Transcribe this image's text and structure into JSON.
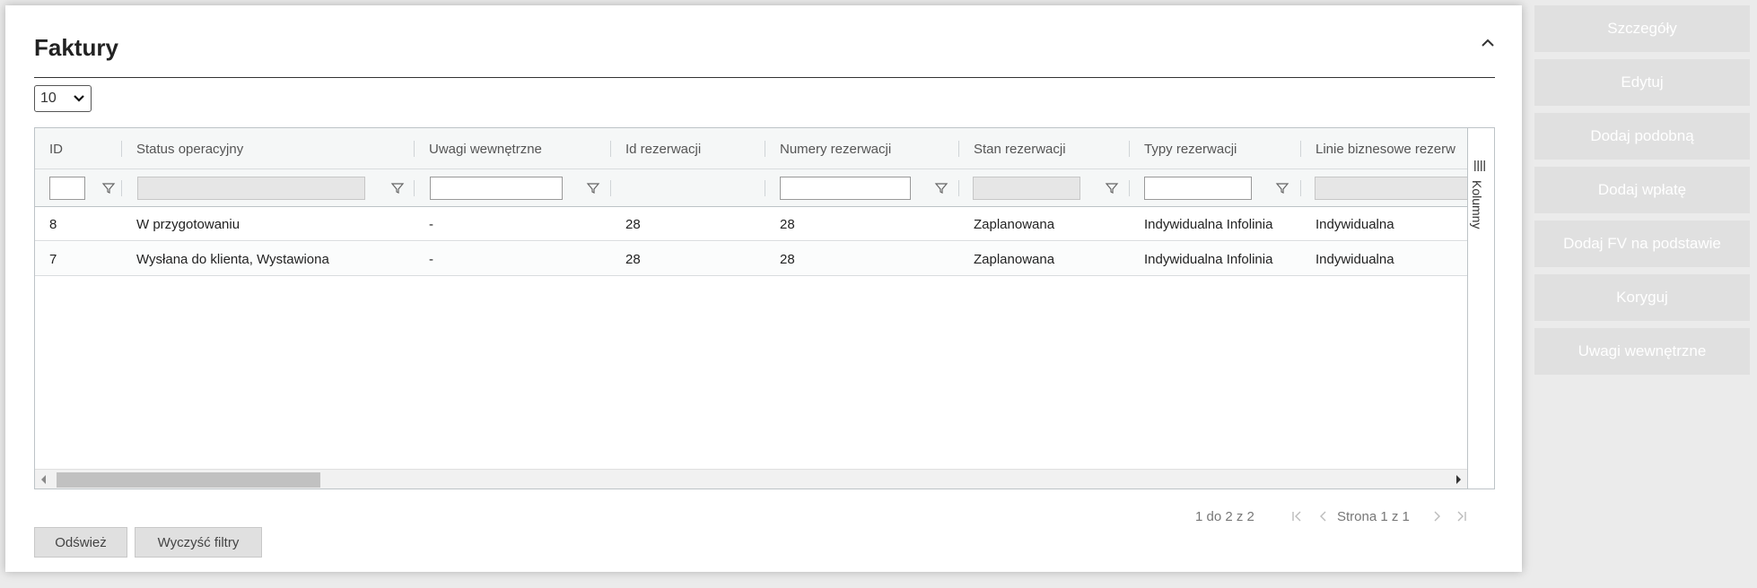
{
  "panel": {
    "title": "Faktury",
    "page_size": "10"
  },
  "grid": {
    "columns": [
      {
        "label": "ID",
        "filter": "input"
      },
      {
        "label": "Status operacyjny",
        "filter": "disabled"
      },
      {
        "label": "Uwagi wewnętrzne",
        "filter": "input"
      },
      {
        "label": "Id rezerwacji",
        "filter": "none"
      },
      {
        "label": "Numery rezerwacji",
        "filter": "input"
      },
      {
        "label": "Stan rezerwacji",
        "filter": "disabled"
      },
      {
        "label": "Typy rezerwacji",
        "filter": "input"
      },
      {
        "label": "Linie biznesowe rezerw",
        "filter": "disabled"
      }
    ],
    "rows": [
      [
        "8",
        "W przygotowaniu",
        "-",
        "28",
        "28",
        "Zaplanowana",
        "Indywidualna Infolinia",
        "Indywidualna"
      ],
      [
        "7",
        "Wysłana do klienta, Wystawiona",
        "-",
        "28",
        "28",
        "Zaplanowana",
        "Indywidualna Infolinia",
        "Indywidualna"
      ]
    ],
    "columns_panel_label": "Kolumny"
  },
  "pager": {
    "summary": "1 do 2 z 2",
    "page_label": "Strona 1 z 1"
  },
  "footer": {
    "refresh": "Odśwież",
    "clear_filters": "Wyczyść filtry"
  },
  "actions": [
    "Szczegóły",
    "Edytuj",
    "Dodaj podobną",
    "Dodaj wpłatę",
    "Dodaj FV na podstawie",
    "Koryguj",
    "Uwagi wewnętrzne"
  ]
}
